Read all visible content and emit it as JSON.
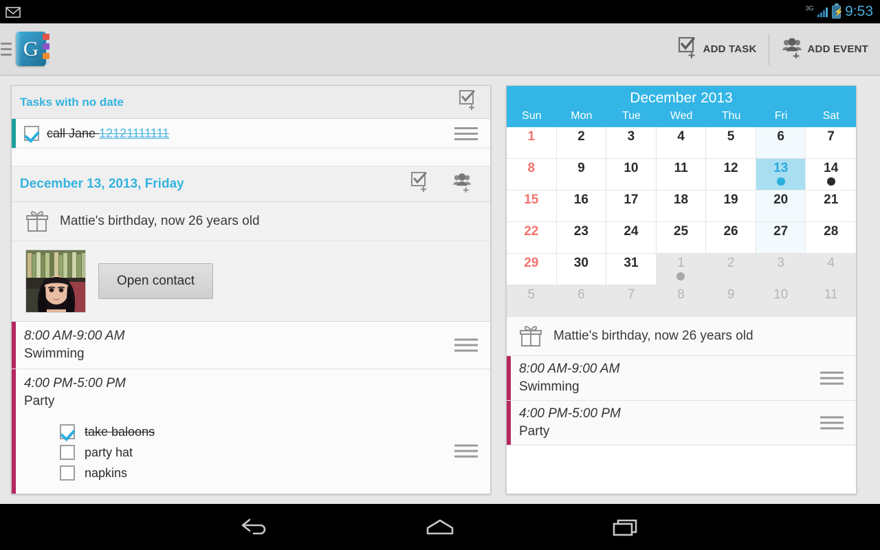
{
  "statusbar": {
    "network_label": "3G",
    "time": "9:53",
    "mail_icon": "gmail-icon",
    "signal_icon": "signal-bars-icon",
    "battery_icon": "battery-charging-icon"
  },
  "actionbar": {
    "app_logo": "app-logo-book-g",
    "drawer_icon": "drawer-grip-icon",
    "add_task_label": "ADD TASK",
    "add_task_icon": "add-task-checkbox-plus-icon",
    "add_event_label": "ADD EVENT",
    "add_event_icon": "add-event-people-plus-icon"
  },
  "left_panel": {
    "no_date_section": {
      "title": "Tasks with no date",
      "add_task_icon": "add-task-icon",
      "task": {
        "checked": true,
        "text": "call Jane ",
        "phone_link": "12121111111",
        "accent_color": "#1aa09c",
        "handle_icon": "drag-handle-icon"
      }
    },
    "date_section": {
      "title": "December 13, 2013, Friday",
      "add_task_icon": "add-task-icon",
      "add_event_icon": "add-event-icon",
      "birthday": {
        "icon": "gift-icon",
        "text": "Mattie's birthday, now 26 years old"
      },
      "contact": {
        "avatar": "contact-photo",
        "open_button_label": "Open contact"
      },
      "events": [
        {
          "time": "8:00 AM-9:00 AM",
          "name": "Swimming",
          "accent_color": "#b5275e",
          "handle_icon": "drag-handle-icon",
          "subtasks": []
        },
        {
          "time": "4:00 PM-5:00 PM",
          "name": "Party",
          "accent_color": "#b5275e",
          "handle_icon": "drag-handle-icon",
          "subtasks": [
            {
              "label": "take baloons",
              "checked": true
            },
            {
              "label": "party hat",
              "checked": false
            },
            {
              "label": "napkins",
              "checked": false
            }
          ]
        }
      ]
    }
  },
  "right_panel": {
    "calendar": {
      "month_title": "December 2013",
      "header_color": "#33b5e5",
      "weekdays": [
        "Sun",
        "Mon",
        "Tue",
        "Wed",
        "Thu",
        "Fri",
        "Sat"
      ],
      "selected_day": 13,
      "days": [
        {
          "n": "1",
          "type": "current",
          "sun": true
        },
        {
          "n": "2",
          "type": "current"
        },
        {
          "n": "3",
          "type": "current"
        },
        {
          "n": "4",
          "type": "current"
        },
        {
          "n": "5",
          "type": "current"
        },
        {
          "n": "6",
          "type": "current",
          "fri": true
        },
        {
          "n": "7",
          "type": "current"
        },
        {
          "n": "8",
          "type": "current",
          "sun": true
        },
        {
          "n": "9",
          "type": "current"
        },
        {
          "n": "10",
          "type": "current"
        },
        {
          "n": "11",
          "type": "current"
        },
        {
          "n": "12",
          "type": "current"
        },
        {
          "n": "13",
          "type": "current",
          "fri": true,
          "selected": true,
          "dot": "blue"
        },
        {
          "n": "14",
          "type": "current",
          "dot": "black"
        },
        {
          "n": "15",
          "type": "current",
          "sun": true
        },
        {
          "n": "16",
          "type": "current"
        },
        {
          "n": "17",
          "type": "current"
        },
        {
          "n": "18",
          "type": "current"
        },
        {
          "n": "19",
          "type": "current"
        },
        {
          "n": "20",
          "type": "current",
          "fri": true
        },
        {
          "n": "21",
          "type": "current"
        },
        {
          "n": "22",
          "type": "current",
          "sun": true
        },
        {
          "n": "23",
          "type": "current"
        },
        {
          "n": "24",
          "type": "current"
        },
        {
          "n": "25",
          "type": "current"
        },
        {
          "n": "26",
          "type": "current"
        },
        {
          "n": "27",
          "type": "current",
          "fri": true
        },
        {
          "n": "28",
          "type": "current"
        },
        {
          "n": "29",
          "type": "current",
          "sun": true
        },
        {
          "n": "30",
          "type": "current"
        },
        {
          "n": "31",
          "type": "current"
        },
        {
          "n": "1",
          "type": "other",
          "dot": "gray"
        },
        {
          "n": "2",
          "type": "other"
        },
        {
          "n": "3",
          "type": "other"
        },
        {
          "n": "4",
          "type": "other"
        },
        {
          "n": "5",
          "type": "other"
        },
        {
          "n": "6",
          "type": "other"
        },
        {
          "n": "7",
          "type": "other"
        },
        {
          "n": "8",
          "type": "other"
        },
        {
          "n": "9",
          "type": "other"
        },
        {
          "n": "10",
          "type": "other"
        },
        {
          "n": "11",
          "type": "other"
        }
      ]
    },
    "day_events": {
      "birthday": {
        "icon": "gift-icon",
        "text": "Mattie's birthday, now 26 years old"
      },
      "events": [
        {
          "time": "8:00 AM-9:00 AM",
          "name": "Swimming",
          "accent_color": "#b5275e",
          "handle_icon": "drag-handle-icon"
        },
        {
          "time": "4:00 PM-5:00 PM",
          "name": "Party",
          "accent_color": "#b5275e",
          "handle_icon": "drag-handle-icon"
        }
      ]
    }
  },
  "navbar": {
    "back_icon": "back-arrow-icon",
    "home_icon": "home-icon",
    "recents_icon": "recent-apps-icon"
  }
}
